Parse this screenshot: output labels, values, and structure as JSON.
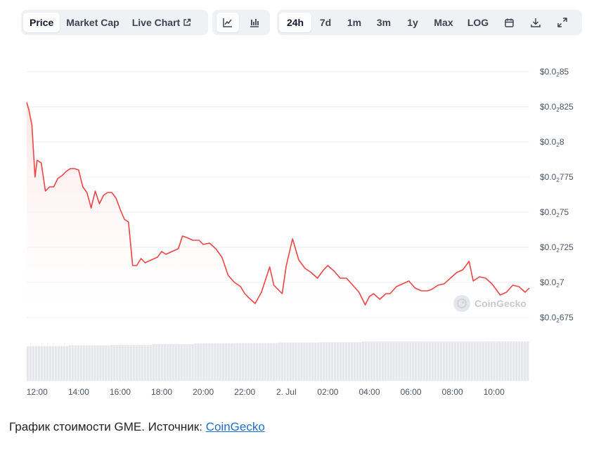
{
  "toolbar": {
    "metric_tabs": [
      "Price",
      "Market Cap",
      "Live Chart"
    ],
    "active_metric": "Price",
    "chart_type_icons": [
      "line-chart-icon",
      "candlestick-chart-icon"
    ],
    "ranges": [
      "24h",
      "7d",
      "1m",
      "3m",
      "1y",
      "Max",
      "LOG"
    ],
    "active_range": "24h",
    "tool_icons": [
      "calendar-icon",
      "download-icon",
      "expand-icon"
    ]
  },
  "colors": {
    "line": "#ef4444",
    "fill": "#fde4e4",
    "volume": "#e5e7eb",
    "grid": "#eceef1",
    "active_tab_bg": "#ffffff",
    "toolbar_bg": "#eff2f5"
  },
  "watermark": "CoinGecko",
  "caption": {
    "text": "График стоимости GME. Источник: ",
    "link": "CoinGecko"
  },
  "chart_data": {
    "type": "area",
    "xlabel": "",
    "ylabel": "",
    "x_tick_labels": [
      "12:00",
      "14:00",
      "16:00",
      "18:00",
      "20:00",
      "22:00",
      "2. Jul",
      "02:00",
      "04:00",
      "06:00",
      "08:00",
      "10:00"
    ],
    "y_tick_labels": [
      {
        "prefix": "$0.0",
        "sub": "2",
        "suffix": "85",
        "value": 0.00085
      },
      {
        "prefix": "$0.0",
        "sub": "2",
        "suffix": "825",
        "value": 0.000825
      },
      {
        "prefix": "$0.0",
        "sub": "2",
        "suffix": "8",
        "value": 0.0008
      },
      {
        "prefix": "$0.0",
        "sub": "2",
        "suffix": "775",
        "value": 0.000775
      },
      {
        "prefix": "$0.0",
        "sub": "2",
        "suffix": "75",
        "value": 0.00075
      },
      {
        "prefix": "$0.0",
        "sub": "2",
        "suffix": "725",
        "value": 0.000725
      },
      {
        "prefix": "$0.0",
        "sub": "2",
        "suffix": "7",
        "value": 0.0007
      },
      {
        "prefix": "$0.0",
        "sub": "2",
        "suffix": "675",
        "value": 0.000675
      }
    ],
    "ylim": [
      0.000675,
      0.00085
    ],
    "x_hours_range": [
      11.5,
      35.7
    ],
    "series": [
      {
        "values_x_hours": [
          11.5,
          11.6,
          11.75,
          11.9,
          12.0,
          12.2,
          12.4,
          12.6,
          12.8,
          13.0,
          13.2,
          13.4,
          13.6,
          13.8,
          14.0,
          14.2,
          14.4,
          14.6,
          14.8,
          15.0,
          15.2,
          15.4,
          15.6,
          15.8,
          16.0,
          16.2,
          16.4,
          16.6,
          16.8,
          17.0,
          17.2,
          17.5,
          17.8,
          18.0,
          18.2,
          18.5,
          18.8,
          19.0,
          19.2,
          19.5,
          19.8,
          20.0,
          20.3,
          20.6,
          20.9,
          21.2,
          21.5,
          21.8,
          22.0,
          22.2,
          22.5,
          22.8,
          23.0,
          23.2,
          23.4,
          23.6,
          23.8,
          24.0,
          24.3,
          24.6,
          24.9,
          25.2,
          25.5,
          25.8,
          26.0,
          26.3,
          26.6,
          26.9,
          27.2,
          27.5,
          27.8,
          28.0,
          28.2,
          28.5,
          28.8,
          29.0,
          29.3,
          29.6,
          29.9,
          30.2,
          30.5,
          30.8,
          31.0,
          31.3,
          31.6,
          31.9,
          32.2,
          32.5,
          32.8,
          33.0,
          33.3,
          33.6,
          33.9,
          34.0,
          34.3,
          34.6,
          34.9,
          35.2,
          35.5,
          35.7
        ],
        "values_y": [
          0.000828,
          0.000823,
          0.000812,
          0.000775,
          0.000787,
          0.000785,
          0.000765,
          0.000768,
          0.000768,
          0.000774,
          0.000776,
          0.000779,
          0.000781,
          0.000781,
          0.00078,
          0.000768,
          0.000764,
          0.000753,
          0.000765,
          0.000756,
          0.000762,
          0.000764,
          0.000764,
          0.00076,
          0.000752,
          0.000745,
          0.000743,
          0.000712,
          0.000712,
          0.000717,
          0.000714,
          0.000716,
          0.000718,
          0.000722,
          0.00072,
          0.000722,
          0.000724,
          0.000733,
          0.000732,
          0.00073,
          0.00073,
          0.000727,
          0.000728,
          0.000724,
          0.000718,
          0.000705,
          0.0007,
          0.000697,
          0.000692,
          0.000689,
          0.000685,
          0.000693,
          0.000702,
          0.000711,
          0.000698,
          0.000695,
          0.000692,
          0.000712,
          0.000731,
          0.000716,
          0.00071,
          0.000707,
          0.000703,
          0.000709,
          0.000712,
          0.000708,
          0.000703,
          0.000703,
          0.000698,
          0.000693,
          0.000684,
          0.00069,
          0.000692,
          0.000688,
          0.000692,
          0.000692,
          0.000697,
          0.000699,
          0.000701,
          0.000696,
          0.000694,
          0.000694,
          0.000695,
          0.000698,
          0.000699,
          0.000703,
          0.000707,
          0.000709,
          0.000715,
          0.000701,
          0.000704,
          0.000703,
          0.000699,
          0.000697,
          0.000691,
          0.000693,
          0.000698,
          0.000697,
          0.000693,
          0.000696
        ]
      }
    ],
    "volume_relative": [
      0.88,
      0.9,
      0.91,
      0.93,
      0.95,
      0.96,
      0.97,
      0.98,
      1.0,
      1.0,
      1.0,
      1.0
    ],
    "grid": true,
    "y_axis_position": "right"
  }
}
